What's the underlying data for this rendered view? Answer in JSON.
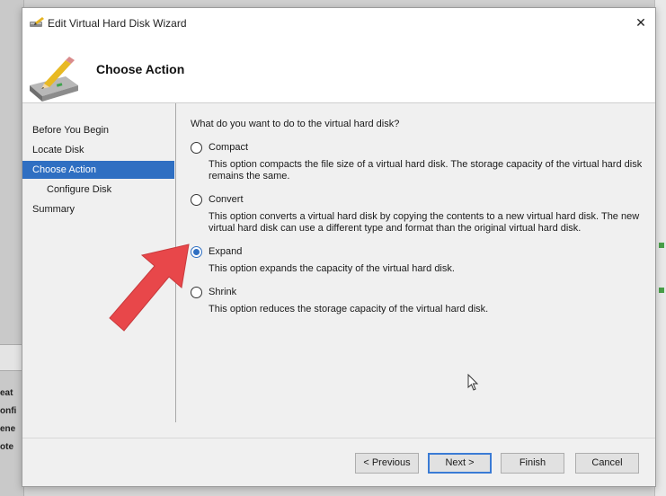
{
  "window": {
    "title": "Edit Virtual Hard Disk Wizard",
    "close_glyph": "✕"
  },
  "header": {
    "title": "Choose Action"
  },
  "nav": {
    "items": [
      {
        "label": "Before You Begin",
        "selected": false,
        "indent": false
      },
      {
        "label": "Locate Disk",
        "selected": false,
        "indent": false
      },
      {
        "label": "Choose Action",
        "selected": true,
        "indent": false
      },
      {
        "label": "Configure Disk",
        "selected": false,
        "indent": true
      },
      {
        "label": "Summary",
        "selected": false,
        "indent": false
      }
    ]
  },
  "main": {
    "question": "What do you want to do to the virtual hard disk?",
    "options": [
      {
        "label": "Compact",
        "selected": false,
        "description": "This option compacts the file size of a virtual hard disk. The storage capacity of the virtual hard disk remains the same."
      },
      {
        "label": "Convert",
        "selected": false,
        "description": "This option converts a virtual hard disk by copying the contents to a new virtual hard disk. The new virtual hard disk can use a different type and format than the original virtual hard disk."
      },
      {
        "label": "Expand",
        "selected": true,
        "description": "This option expands the capacity of the virtual hard disk."
      },
      {
        "label": "Shrink",
        "selected": false,
        "description": "This option reduces the storage capacity of the virtual hard disk."
      }
    ]
  },
  "buttons": {
    "previous": "< Previous",
    "next": "Next >",
    "finish": "Finish",
    "cancel": "Cancel"
  },
  "background": {
    "fragments": [
      "eat",
      "onfi",
      "ene",
      "ote"
    ]
  },
  "colors": {
    "selection": "#2f6fc2",
    "arrow": "#e8474a"
  },
  "icons": {
    "title": "disk-pencil-icon",
    "header": "disk-pencil-icon",
    "close": "close-icon",
    "pointer": "mouse-cursor-icon",
    "annotation": "red-arrow-icon"
  }
}
